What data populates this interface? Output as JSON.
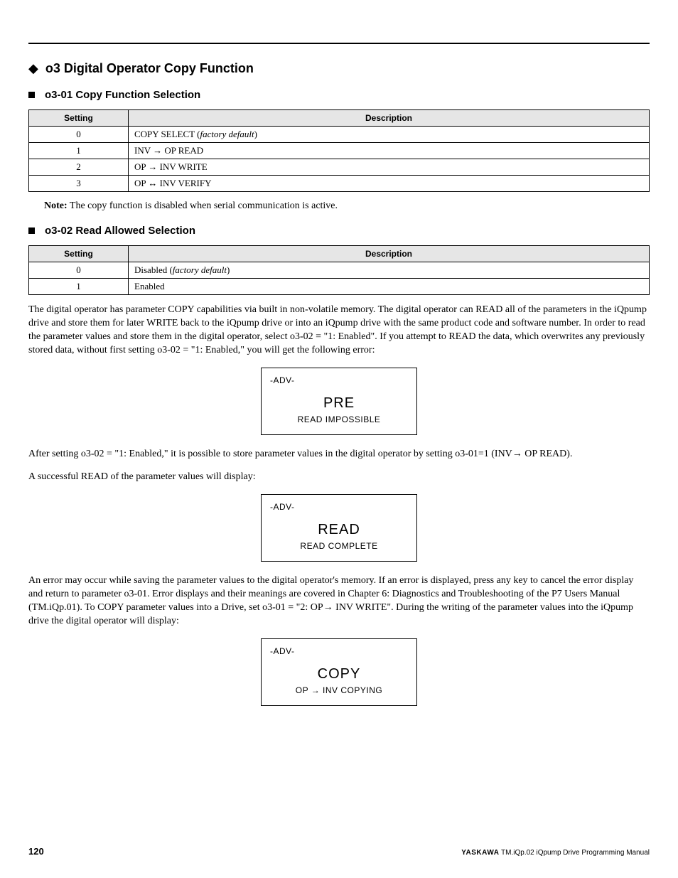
{
  "section": {
    "title": "o3 Digital Operator Copy Function"
  },
  "sub1": {
    "title": "o3-01 Copy Function Selection",
    "headers": {
      "setting": "Setting",
      "desc": "Description"
    },
    "rows": [
      {
        "setting": "0",
        "desc_pre": "COPY SELECT (",
        "desc_italic": "factory default",
        "desc_post": ")"
      },
      {
        "setting": "1",
        "desc": "INV → OP READ"
      },
      {
        "setting": "2",
        "desc": "OP →  INV WRITE"
      },
      {
        "setting": "3",
        "desc": "OP ↔  INV VERIFY"
      }
    ],
    "note_label": "Note:",
    "note_text": "The copy function is disabled when serial communication is active."
  },
  "sub2": {
    "title": "o3-02 Read Allowed Selection",
    "headers": {
      "setting": "Setting",
      "desc": "Description"
    },
    "rows": [
      {
        "setting": "0",
        "desc_pre": "Disabled (",
        "desc_italic": "factory default",
        "desc_post": ")"
      },
      {
        "setting": "1",
        "desc": "Enabled"
      }
    ]
  },
  "para1": "The digital operator has parameter COPY capabilities via built in non-volatile memory. The digital operator can READ all of the parameters in the iQpump drive and store them for later WRITE back to the iQpump drive or into an iQpump drive with the same product code and software number. In order to read the parameter values and store them in the digital operator, select o3-02 = \"1: Enabled\". If you attempt to READ the data, which overwrites any previously stored data, without first setting o3-02 = \"1: Enabled,\" you will get the following error:",
  "disp1": {
    "adv": "-ADV-",
    "big": "PRE",
    "small": "READ IMPOSSIBLE"
  },
  "para2": "After setting o3-02 = \"1: Enabled,\" it is possible to store parameter values in the digital operator by setting o3-01=1 (INV→  OP READ).",
  "para3": "A successful READ of the parameter values will display:",
  "disp2": {
    "adv": "-ADV-",
    "big": "READ",
    "small": "READ COMPLETE"
  },
  "para4": "An error may occur while saving the parameter values to the digital operator's memory. If an error is displayed, press any key to cancel the error display and return to parameter o3-01. Error displays and their meanings are covered in Chapter 6: Diagnostics and Troubleshooting of the P7 Users Manual (TM.iQp.01). To COPY parameter values into a Drive, set o3-01 = \"2: OP→  INV WRITE\". During the writing of the parameter values into the iQpump drive the digital operator will display:",
  "disp3": {
    "adv": "-ADV-",
    "big": "COPY",
    "small": "OP → INV COPYING"
  },
  "footer": {
    "page": "120",
    "brand": "YASKAWA",
    "doc": " TM.iQp.02 iQpump Drive Programming Manual"
  }
}
